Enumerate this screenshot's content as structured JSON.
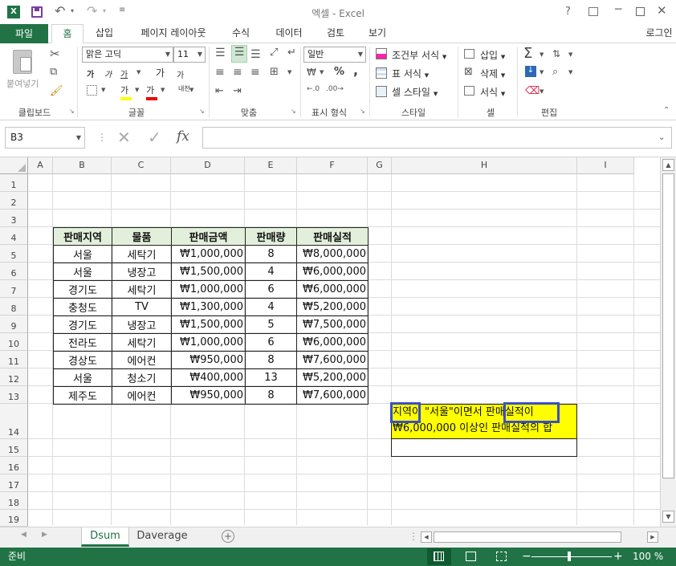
{
  "app": {
    "title": "엑셀 - Excel",
    "account": "로그인",
    "help": "?",
    "excel_icon": "X"
  },
  "tabs": [
    {
      "label": "파일"
    },
    {
      "label": "홈"
    },
    {
      "label": "삽입"
    },
    {
      "label": "페이지 레이아웃"
    },
    {
      "label": "수식"
    },
    {
      "label": "데이터"
    },
    {
      "label": "검토"
    },
    {
      "label": "보기"
    }
  ],
  "ribbon": {
    "clipboard": {
      "paste": "붙여넣기",
      "group": "클립보드"
    },
    "font": {
      "name": "맑은 고딕",
      "size": "11",
      "group": "글꼴",
      "bold": "가",
      "italic": "가",
      "underline": "가",
      "grow": "가",
      "shrink": "가",
      "fill": "가",
      "color": "가",
      "phonetic": "내천"
    },
    "align": {
      "group": "맞춤"
    },
    "number": {
      "format": "일반",
      "group": "표시 형식",
      "percent": "%",
      "comma": ","
    },
    "styles": {
      "cond": "조건부 서식",
      "table": "표 서식",
      "cell": "셀 스타일",
      "group": "스타일"
    },
    "cells": {
      "insert": "삽입",
      "delete": "삭제",
      "format": "서식",
      "group": "셀"
    },
    "editing": {
      "group": "편집"
    }
  },
  "formula_bar": {
    "name_box": "B3",
    "fx": "fx",
    "value": ""
  },
  "columns": [
    "A",
    "B",
    "C",
    "D",
    "E",
    "F",
    "G",
    "H",
    "I"
  ],
  "rows": [
    "1",
    "2",
    "3",
    "4",
    "5",
    "6",
    "7",
    "8",
    "9",
    "10",
    "11",
    "12",
    "13",
    "14",
    "15",
    "16",
    "17",
    "18",
    "19"
  ],
  "table": {
    "headers": [
      "판매지역",
      "물품",
      "판매금액",
      "판매량",
      "판매실적"
    ],
    "rows": [
      [
        "서울",
        "세탁기",
        "₩1,000,000",
        "8",
        "₩8,000,000"
      ],
      [
        "서울",
        "냉장고",
        "₩1,500,000",
        "4",
        "₩6,000,000"
      ],
      [
        "경기도",
        "세탁기",
        "₩1,000,000",
        "6",
        "₩6,000,000"
      ],
      [
        "충청도",
        "TV",
        "₩1,300,000",
        "4",
        "₩5,200,000"
      ],
      [
        "경기도",
        "냉장고",
        "₩1,500,000",
        "5",
        "₩7,500,000"
      ],
      [
        "전라도",
        "세탁기",
        "₩1,000,000",
        "6",
        "₩6,000,000"
      ],
      [
        "경상도",
        "에어컨",
        "₩950,000",
        "8",
        "₩7,600,000"
      ],
      [
        "서울",
        "청소기",
        "₩400,000",
        "13",
        "₩5,200,000"
      ],
      [
        "제주도",
        "에어컨",
        "₩950,000",
        "8",
        "₩7,600,000"
      ]
    ]
  },
  "note": {
    "line1": "지역이 \"서울\"이면서 판매실적이",
    "line2": "₩6,000,000 이상인 판매실적의 합"
  },
  "sheets": [
    {
      "label": "Dsum",
      "active": true
    },
    {
      "label": "Daverage",
      "active": false
    }
  ],
  "status": {
    "ready": "준비",
    "zoom": "100 %"
  },
  "colors": {
    "accent": "#217346",
    "header_fill": "#e2efda",
    "note_fill": "#ffff00",
    "highlight": "#3b4fc4"
  }
}
